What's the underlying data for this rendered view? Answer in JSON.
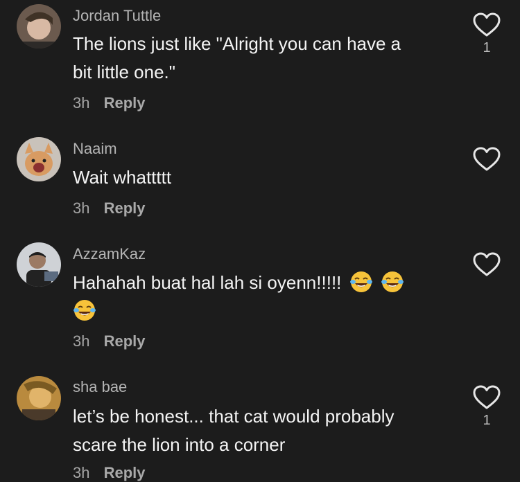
{
  "comments": [
    {
      "username": "Jordan Tuttle",
      "lines": [
        "The lions just like \"Alright you can have a",
        "bit little one.\""
      ],
      "time": "3h",
      "reply_label": "Reply",
      "likes": "1",
      "avatar": "avatar-jordan"
    },
    {
      "username": "Naaim",
      "lines": [
        "Wait whattttt"
      ],
      "time": "3h",
      "reply_label": "Reply",
      "likes": "",
      "avatar": "avatar-naaim"
    },
    {
      "username": "AzzamKaz",
      "lines": [
        "Hahahah buat hal lah si oyenn!!!!!"
      ],
      "emoji": "face-with-tears-of-joy",
      "time": "3h",
      "reply_label": "Reply",
      "likes": "",
      "avatar": "avatar-azzam"
    },
    {
      "username": "sha bae",
      "lines": [
        "let’s be honest... that cat would probably",
        "scare the lion into a corner"
      ],
      "time": "3h",
      "reply_label": "Reply",
      "likes": "1",
      "avatar": "avatar-sha"
    }
  ],
  "icons": {
    "like": "heart-outline-icon",
    "emoji": "face-with-tears-of-joy"
  },
  "colors": {
    "background": "#1c1c1c",
    "username": "#b4b4b4",
    "text": "#f4f4f4",
    "meta": "#a5a5a5"
  }
}
